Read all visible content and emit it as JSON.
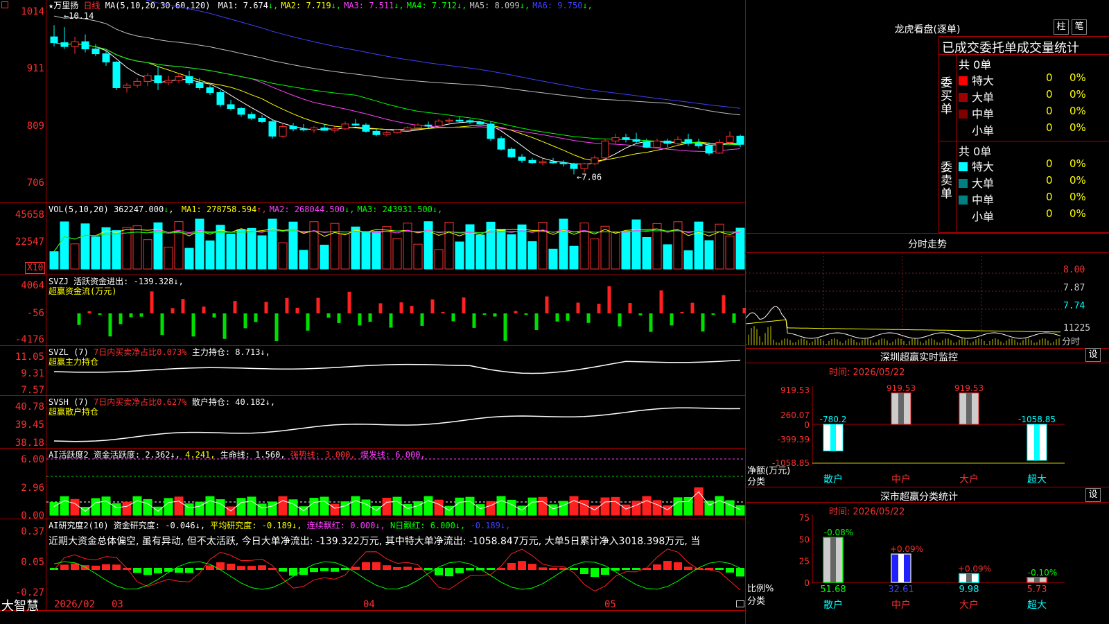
{
  "stock_name": "★万里扬",
  "period": "日线",
  "price_panel": {
    "ma_header": "MA(5,10,20,30,60,120)",
    "ma": [
      {
        "label": "MA1: 7.674",
        "arrow": "↓",
        "color": "#ffffff"
      },
      {
        "label": "MA2: 7.719",
        "arrow": "↓",
        "color": "#ffff00"
      },
      {
        "label": "MA3: 7.511",
        "arrow": "↓",
        "color": "#ff40ff"
      },
      {
        "label": "MA4: 7.712",
        "arrow": "↓",
        "color": "#00ff00"
      },
      {
        "label": "MA5: 8.099",
        "arrow": "↓",
        "color": "#c0c0c0"
      },
      {
        "label": "MA6: 9.750",
        "arrow": "↓",
        "color": "#4040ff"
      }
    ],
    "y_labels": [
      "1014",
      "911",
      "809",
      "706"
    ],
    "high_label": "10.14",
    "low_label": "7.06"
  },
  "vol_panel": {
    "header": "VOL(5,10,20)",
    "value": "362247.000",
    "ma": [
      {
        "label": "MA1: 278758.594",
        "arrow": "↑",
        "color": "#ffff00"
      },
      {
        "label": "MA2: 268044.500",
        "arrow": "↓",
        "color": "#ff40ff"
      },
      {
        "label": "MA3: 243931.500",
        "arrow": "↓",
        "color": "#00ff00"
      }
    ],
    "y_labels": [
      "45658",
      "22547"
    ],
    "unit": "X10"
  },
  "svzj_panel": {
    "header": "SVZJ  活跃资金进出: -139.328↓,",
    "sub": "超赢资金流(万元)",
    "y_labels": [
      "4064",
      "-56",
      "-4176"
    ]
  },
  "svzl_panel": {
    "header_a": "SVZL (7)",
    "header_b": "7日内买卖净占比0.073%",
    "header_c": "主力持仓: 8.713↓,",
    "sub": "超赢主力持仓",
    "y_labels": [
      "11.05",
      "9.31",
      "7.57"
    ]
  },
  "svsh_panel": {
    "header_a": "SVSH (7)",
    "header_b": "7日内买卖净占比0.627%",
    "header_c": "散户持仓: 40.182↓,",
    "sub": "超赢散户持仓",
    "y_labels": [
      "40.78",
      "39.45",
      "38.18"
    ]
  },
  "ai_panel": {
    "header_a": "AI活跃度2 资金活跃度: 2.362↓,",
    "header_b": "4.241,",
    "header_c": "生命线: 1.560,",
    "header_d": "强势线: 3.000,",
    "header_e": "爆发线: 6.000,",
    "y_labels": [
      "6.00",
      "2.96",
      "0.00"
    ]
  },
  "research_panel": {
    "header_a": "AI研究度2(10) 资金研究度: -0.046↓,",
    "header_b": "平均研究度: -0.189↓,",
    "header_c": "连续飘红: 0.000↓,",
    "header_d": "N日飘红: 6.000↓,",
    "header_e": "-0.189↓,",
    "comment": "近期大资金总体偏空, 虽有异动, 但不太活跃, 今日大单净流出: -139.322万元, 其中特大单净流出: -1058.847万元, 大单5日累计净入3018.398万元, 当",
    "y_labels": [
      "0.37",
      "0.05",
      "-0.27"
    ]
  },
  "x_axis": {
    "labels": [
      "2026/02",
      "03",
      "04",
      "05"
    ],
    "logo": "大智慧"
  },
  "lhb": {
    "title": "龙虎看盘(逐单)",
    "btn_bar": "柱",
    "btn_pen": "笔",
    "subtitle": "已成交委托单成交量统计",
    "buy_title": "委买单",
    "sell_title": "委卖单",
    "buy_total": "共 0单",
    "sell_total": "共 0单",
    "buy_rows": [
      {
        "name": "特大",
        "count": "0",
        "pct": "0%",
        "color": "#ff0000"
      },
      {
        "name": "大单",
        "count": "0",
        "pct": "0%",
        "color": "#a00000"
      },
      {
        "name": "中单",
        "count": "0",
        "pct": "0%",
        "color": "#800000"
      },
      {
        "name": "小单",
        "count": "0",
        "pct": "0%",
        "color": "#000000"
      }
    ],
    "sell_rows": [
      {
        "name": "特大",
        "count": "0",
        "pct": "0%",
        "color": "#00ffff"
      },
      {
        "name": "大单",
        "count": "0",
        "pct": "0%",
        "color": "#008080"
      },
      {
        "name": "中单",
        "count": "0",
        "pct": "0%",
        "color": "#008080"
      },
      {
        "name": "小单",
        "count": "0",
        "pct": "0%",
        "color": "#000000"
      }
    ]
  },
  "intraday": {
    "title": "分时走势",
    "y_labels": [
      "8.00",
      "7.87",
      "7.74",
      "11225"
    ],
    "unit": "分时"
  },
  "monitor": {
    "title": "深圳超赢实时监控",
    "set": "设",
    "time": "时间: 2026/05/22",
    "unit": "净额(万元)",
    "cat_label": "分类",
    "y_labels": [
      "919.53",
      "260.07",
      "0",
      "-399.39",
      "-1058.85"
    ],
    "categories": [
      "散户",
      "中户",
      "大户",
      "超大"
    ],
    "values": [
      "-780.2",
      "919.53",
      "919.53",
      "-1058.85"
    ]
  },
  "classify": {
    "title": "深市超赢分类统计",
    "set": "设",
    "time": "时间: 2026/05/22",
    "unit": "比例%",
    "cat_label": "分类",
    "y_labels": [
      "75",
      "50",
      "25",
      "0"
    ],
    "categories": [
      "散户",
      "中户",
      "大户",
      "超大"
    ],
    "values": [
      "51.68",
      "32.61",
      "9.98",
      "5.73"
    ],
    "changes": [
      "-0.08%",
      "+0.09%",
      "+0.09%",
      "-0.10%"
    ]
  },
  "chart_data": [
    {
      "type": "candlestick",
      "title": "★万里扬 日线",
      "x": [
        "2026/02",
        "03",
        "04",
        "05"
      ],
      "ohlc": [
        [
          9.9,
          10.14,
          9.7,
          9.78
        ],
        [
          9.78,
          10.1,
          9.65,
          9.7
        ],
        [
          9.7,
          9.9,
          9.55,
          9.8
        ],
        [
          9.8,
          9.95,
          9.58,
          9.65
        ],
        [
          9.65,
          9.75,
          9.5,
          9.55
        ],
        [
          9.55,
          9.6,
          9.3,
          9.38
        ],
        [
          9.38,
          9.4,
          8.8,
          8.85
        ],
        [
          8.85,
          8.95,
          8.75,
          8.9
        ],
        [
          8.9,
          9.05,
          8.85,
          8.98
        ],
        [
          8.98,
          9.15,
          8.88,
          9.1
        ],
        [
          9.1,
          9.3,
          8.8,
          8.95
        ],
        [
          8.95,
          9.1,
          8.9,
          9.0
        ],
        [
          9.0,
          9.15,
          8.95,
          9.08
        ],
        [
          9.08,
          9.2,
          8.9,
          8.95
        ],
        [
          8.95,
          9.05,
          8.8,
          8.85
        ],
        [
          8.85,
          8.9,
          8.7,
          8.75
        ],
        [
          8.75,
          8.8,
          8.45,
          8.5
        ],
        [
          8.5,
          8.6,
          8.38,
          8.42
        ],
        [
          8.42,
          8.45,
          8.25,
          8.3
        ],
        [
          8.3,
          8.35,
          8.18,
          8.22
        ],
        [
          8.22,
          8.28,
          8.12,
          8.15
        ],
        [
          8.15,
          8.2,
          7.8,
          7.85
        ],
        [
          7.85,
          8.1,
          7.82,
          8.05
        ],
        [
          8.05,
          8.12,
          7.95,
          8.0
        ],
        [
          8.0,
          8.1,
          7.95,
          7.98
        ],
        [
          7.98,
          8.06,
          7.92,
          8.02
        ],
        [
          8.02,
          8.1,
          7.96,
          7.97
        ],
        [
          7.97,
          8.05,
          7.92,
          8.0
        ],
        [
          8.0,
          8.15,
          7.98,
          8.1
        ],
        [
          8.1,
          8.2,
          8.05,
          8.08
        ],
        [
          8.08,
          8.12,
          7.92,
          7.95
        ],
        [
          7.95,
          8.0,
          7.85,
          7.88
        ],
        [
          7.88,
          7.96,
          7.84,
          7.92
        ],
        [
          7.92,
          8.0,
          7.9,
          7.98
        ],
        [
          7.98,
          8.05,
          7.95,
          8.02
        ],
        [
          8.02,
          8.12,
          7.98,
          8.08
        ],
        [
          8.08,
          8.15,
          8.02,
          8.06
        ],
        [
          8.06,
          8.2,
          8.04,
          8.16
        ],
        [
          8.16,
          8.22,
          8.12,
          8.18
        ],
        [
          8.18,
          8.25,
          8.14,
          8.17
        ],
        [
          8.17,
          8.2,
          8.1,
          8.14
        ],
        [
          8.14,
          8.16,
          8.12,
          8.1
        ],
        [
          8.1,
          8.15,
          7.75,
          7.8
        ],
        [
          7.8,
          7.85,
          7.55,
          7.58
        ],
        [
          7.58,
          7.62,
          7.4,
          7.42
        ],
        [
          7.42,
          7.48,
          7.3,
          7.35
        ],
        [
          7.35,
          7.4,
          7.28,
          7.3
        ],
        [
          7.3,
          7.38,
          7.25,
          7.32
        ],
        [
          7.32,
          7.4,
          7.28,
          7.3
        ],
        [
          7.3,
          7.35,
          7.22,
          7.28
        ],
        [
          7.28,
          7.3,
          7.06,
          7.18
        ],
        [
          7.18,
          7.3,
          7.1,
          7.28
        ],
        [
          7.28,
          7.45,
          7.25,
          7.4
        ],
        [
          7.4,
          7.8,
          7.38,
          7.75
        ],
        [
          7.75,
          7.9,
          7.7,
          7.82
        ],
        [
          7.82,
          7.9,
          7.72,
          7.78
        ],
        [
          7.78,
          7.92,
          7.7,
          7.74
        ],
        [
          7.74,
          7.8,
          7.6,
          7.62
        ],
        [
          7.62,
          7.8,
          7.6,
          7.75
        ],
        [
          7.75,
          7.8,
          7.62,
          7.7
        ],
        [
          7.7,
          7.85,
          7.66,
          7.78
        ],
        [
          7.78,
          7.9,
          7.65,
          7.7
        ],
        [
          7.7,
          7.8,
          7.6,
          7.65
        ],
        [
          7.65,
          7.72,
          7.45,
          7.5
        ],
        [
          7.5,
          7.78,
          7.48,
          7.72
        ],
        [
          7.72,
          7.95,
          7.65,
          7.85
        ],
        [
          7.85,
          7.88,
          7.62,
          7.68
        ]
      ]
    }
  ]
}
